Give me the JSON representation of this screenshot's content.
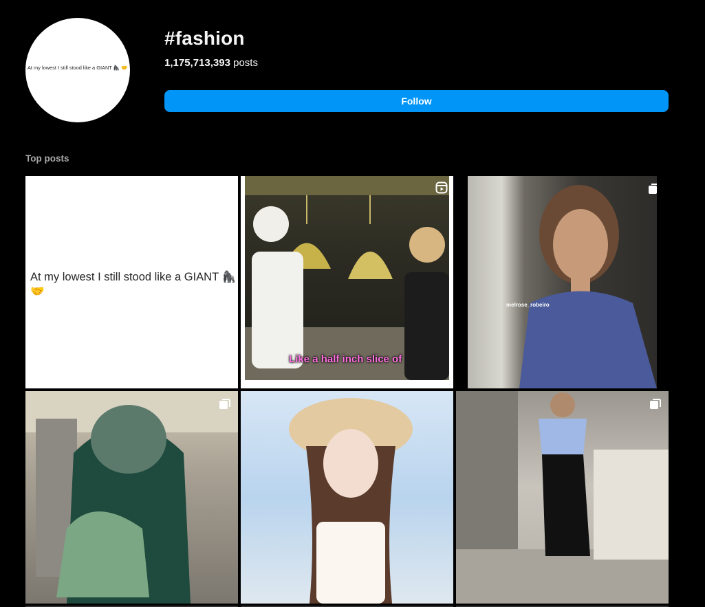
{
  "hashtag": {
    "title": "#fashion",
    "post_count": "1,175,713,393",
    "post_count_suffix": "posts",
    "avatar_text": "At my lowest I still stood like a GIANT 🦍 🤝"
  },
  "follow_button": {
    "label": "Follow"
  },
  "top_posts": {
    "section_title": "Top posts",
    "posts": [
      {
        "type": "text-image",
        "text": "At my lowest I still stood like a GIANT 🦍 🤝",
        "badge": ""
      },
      {
        "type": "reel",
        "caption": "Like a half inch slice of",
        "badge": "reel-icon"
      },
      {
        "type": "carousel",
        "handle": "melrose_robeiro",
        "badge": "carousel-icon"
      },
      {
        "type": "carousel",
        "badge": "carousel-icon"
      },
      {
        "type": "image",
        "badge": ""
      },
      {
        "type": "carousel",
        "badge": "carousel-icon"
      }
    ]
  },
  "colors": {
    "background": "#000000",
    "primary_text": "#f5f5f5",
    "secondary_text": "#a8a8a8",
    "follow_button": "#0095f6"
  }
}
